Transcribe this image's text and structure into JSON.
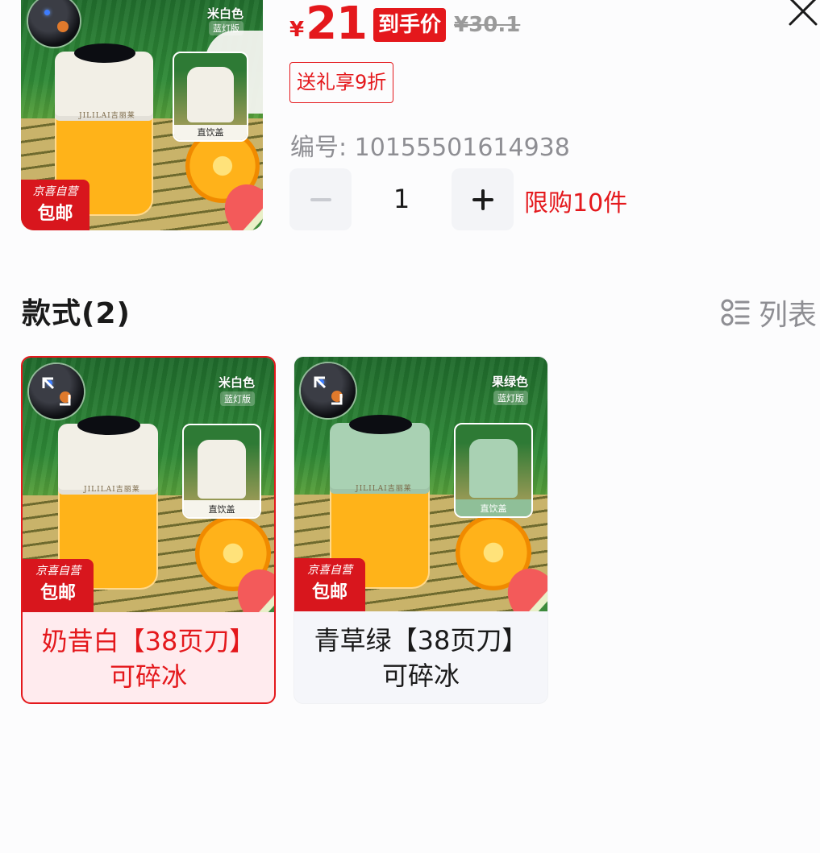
{
  "colors": {
    "accent": "#e4181c",
    "muted": "#8e8e93",
    "selected_bg": "#ffebee",
    "card_bg": "#f5f6fa"
  },
  "product": {
    "price_symbol": "¥",
    "price": "21",
    "price_tag": "到手价",
    "original_price": "¥30.1",
    "promo": "送礼享9折",
    "sku": "编号: 10155501614938",
    "quantity": "1",
    "limit": "限购10件"
  },
  "main_image": {
    "color_name": "米白色",
    "variant": "蓝灯版",
    "inset_caption": "直饮盖",
    "brand": "JILILAI吉丽莱",
    "badge_line1": "京喜自营",
    "badge_line2": "包邮"
  },
  "options_section": {
    "title": "款式(2)",
    "list_toggle_label": "列表",
    "list_toggle_icon": "list-icon",
    "options": [
      {
        "label_line1": "奶昔白【38页刀】",
        "label_line2": "可碎冰",
        "color_name": "米白色",
        "variant": "蓝灯版",
        "inset_caption": "直饮盖",
        "brand": "JILILAI吉丽莱",
        "badge_line1": "京喜自营",
        "badge_line2": "包邮",
        "selected": true
      },
      {
        "label_line1": "青草绿【38页刀】",
        "label_line2": "可碎冰",
        "color_name": "果绿色",
        "variant": "蓝灯版",
        "inset_caption": "直饮盖",
        "brand": "JILILAI吉丽莱",
        "badge_line1": "京喜自营",
        "badge_line2": "包邮",
        "selected": false
      }
    ]
  }
}
